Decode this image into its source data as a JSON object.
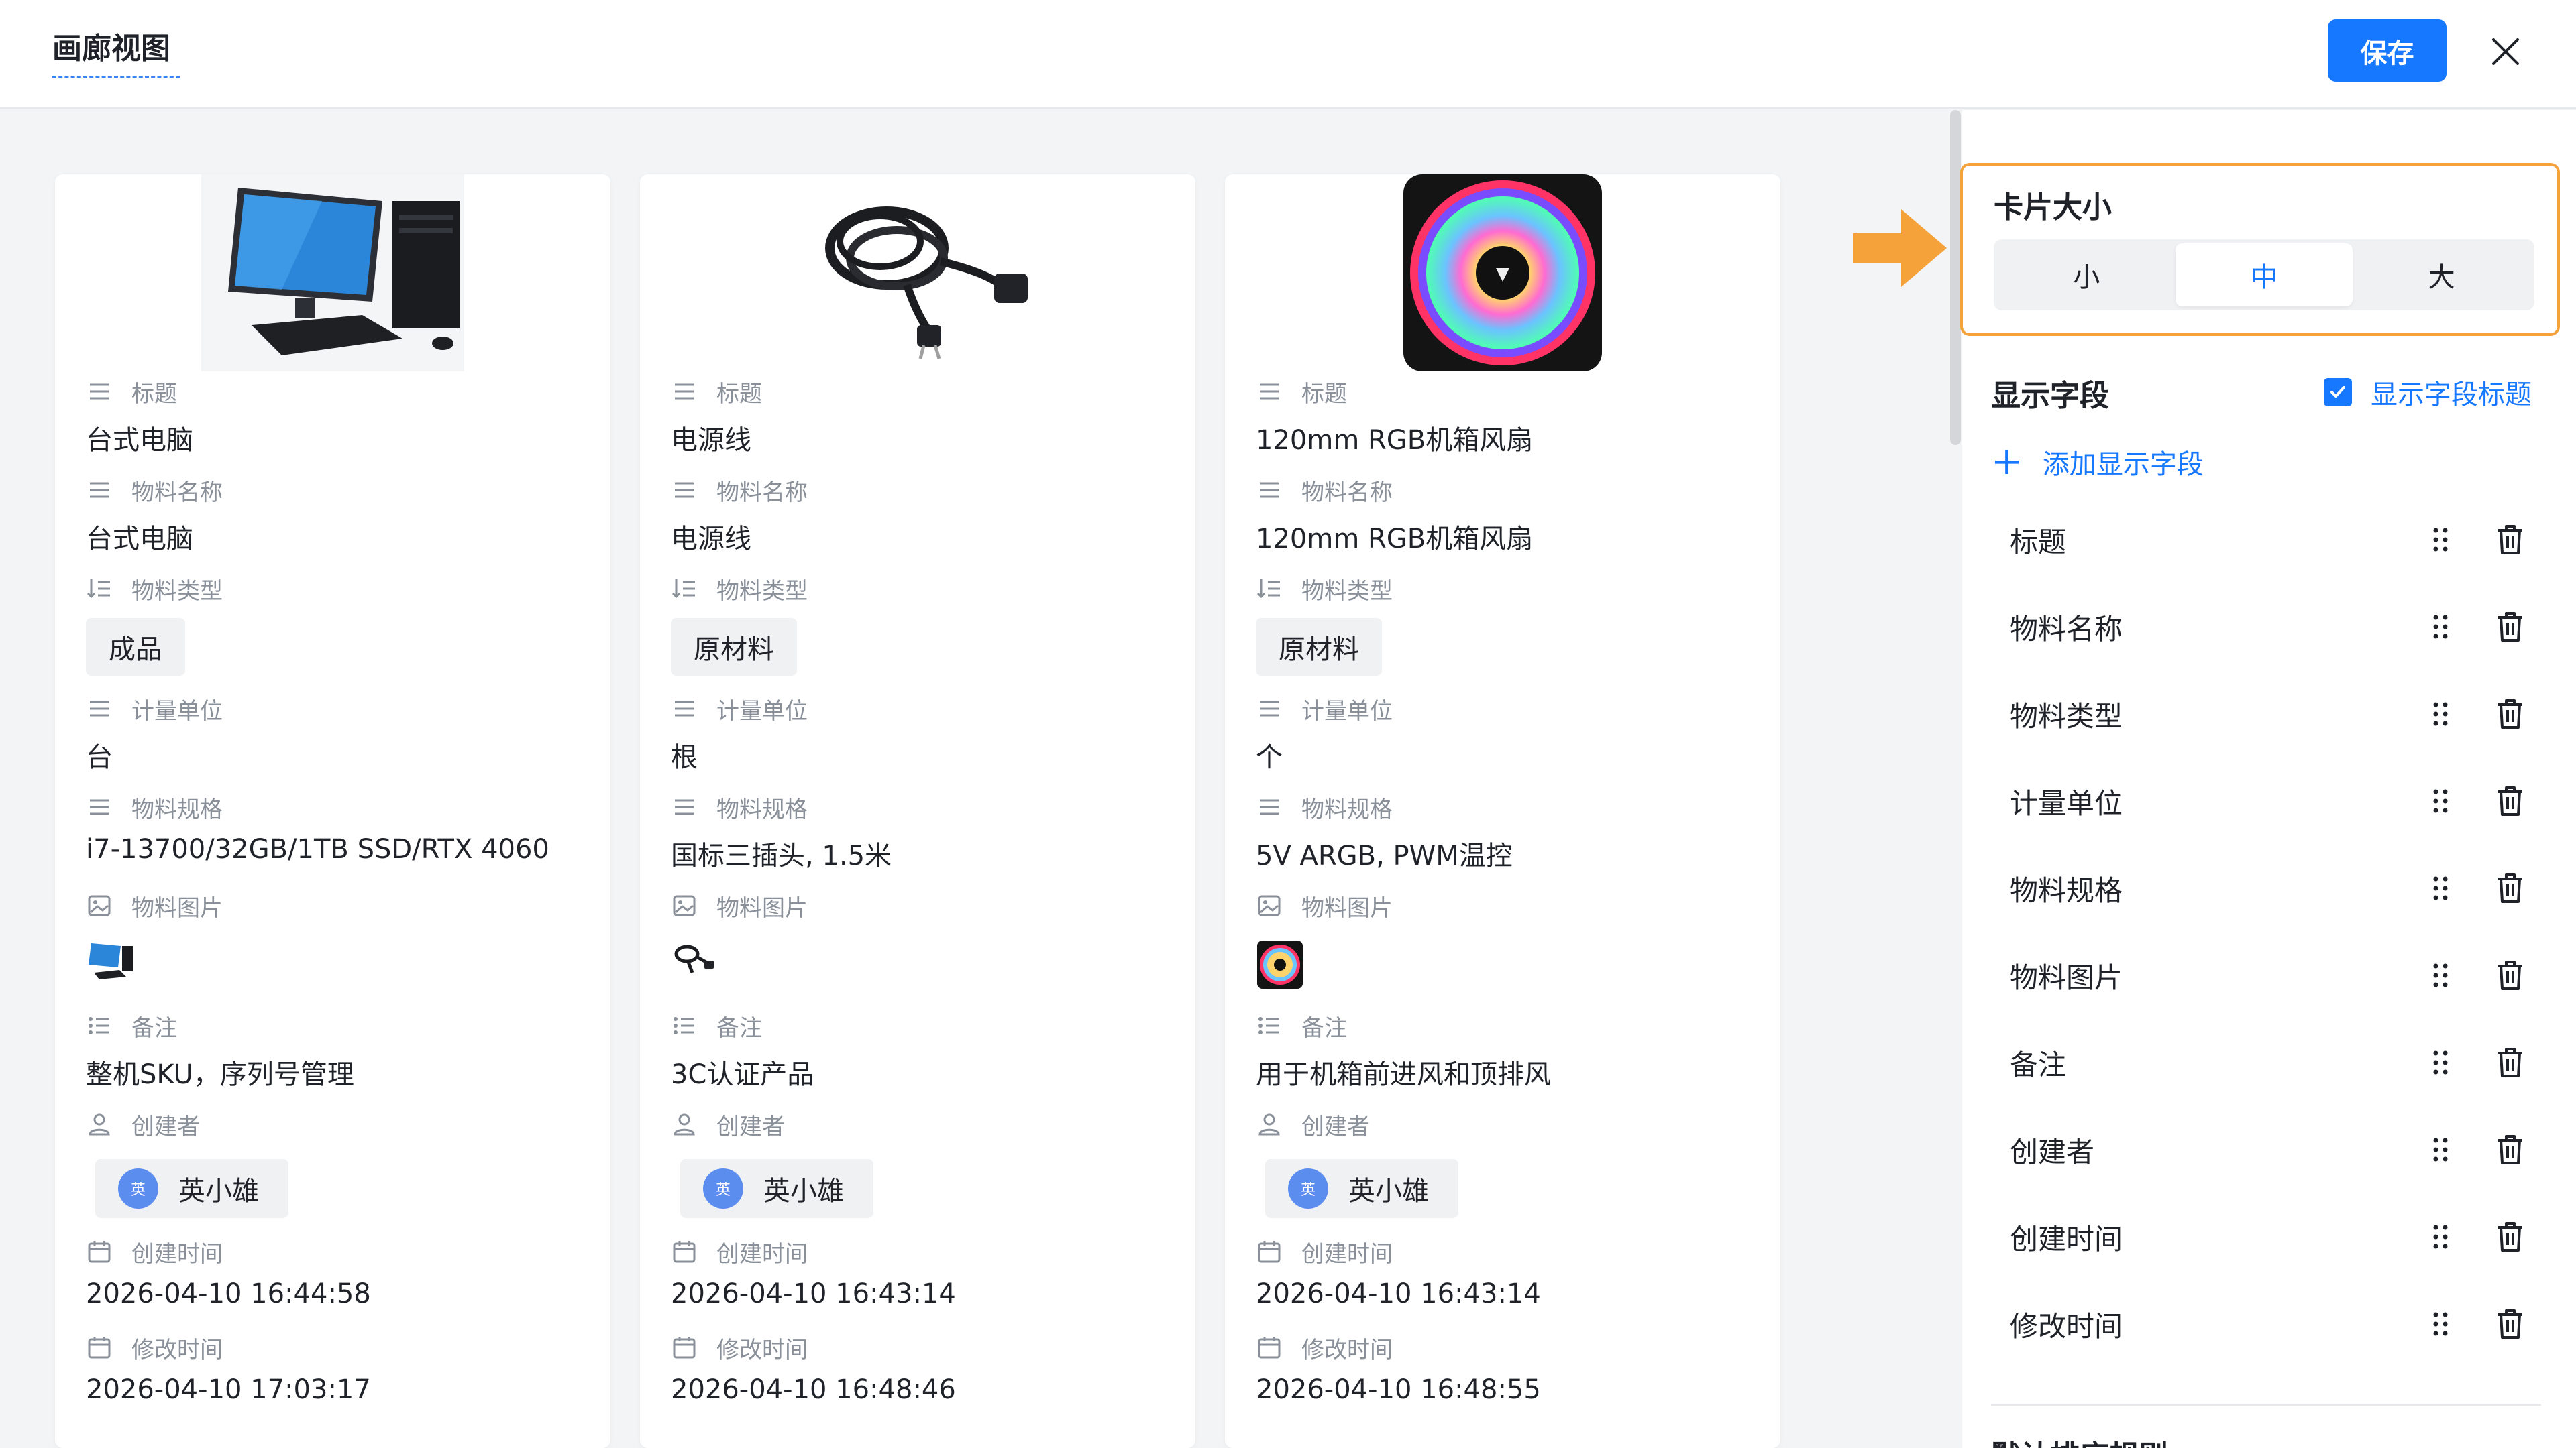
{
  "header": {
    "title": "画廊视图",
    "save_label": "保存"
  },
  "cards": [
    {
      "image": "desktop-computer",
      "fields": {
        "title_label": "标题",
        "title_value": "台式电脑",
        "name_label": "物料名称",
        "name_value": "台式电脑",
        "type_label": "物料类型",
        "type_value": "成品",
        "unit_label": "计量单位",
        "unit_value": "台",
        "spec_label": "物料规格",
        "spec_value": "i7-13700/32GB/1TB SSD/RTX 4060",
        "image_label": "物料图片",
        "note_label": "备注",
        "note_value": "整机SKU，序列号管理",
        "creator_label": "创建者",
        "creator_value": "英小雄",
        "creator_avatar": "英",
        "created_label": "创建时间",
        "created_value": "2026-04-10 16:44:58",
        "modified_label": "修改时间",
        "modified_value": "2026-04-10 17:03:17"
      }
    },
    {
      "image": "power-cable",
      "fields": {
        "title_label": "标题",
        "title_value": "电源线",
        "name_label": "物料名称",
        "name_value": "电源线",
        "type_label": "物料类型",
        "type_value": "原材料",
        "unit_label": "计量单位",
        "unit_value": "根",
        "spec_label": "物料规格",
        "spec_value": "国标三插头, 1.5米",
        "image_label": "物料图片",
        "note_label": "备注",
        "note_value": "3C认证产品",
        "creator_label": "创建者",
        "creator_value": "英小雄",
        "creator_avatar": "英",
        "created_label": "创建时间",
        "created_value": "2026-04-10 16:43:14",
        "modified_label": "修改时间",
        "modified_value": "2026-04-10 16:48:46"
      }
    },
    {
      "image": "rgb-case-fan",
      "fields": {
        "title_label": "标题",
        "title_value": "120mm RGB机箱风扇",
        "name_label": "物料名称",
        "name_value": "120mm RGB机箱风扇",
        "type_label": "物料类型",
        "type_value": "原材料",
        "unit_label": "计量单位",
        "unit_value": "个",
        "spec_label": "物料规格",
        "spec_value": "5V ARGB, PWM温控",
        "image_label": "物料图片",
        "note_label": "备注",
        "note_value": "用于机箱前进风和顶排风",
        "creator_label": "创建者",
        "creator_value": "英小雄",
        "creator_avatar": "英",
        "created_label": "创建时间",
        "created_value": "2026-04-10 16:43:14",
        "modified_label": "修改时间",
        "modified_value": "2026-04-10 16:48:55"
      }
    }
  ],
  "panel": {
    "card_size_label": "卡片大小",
    "size_options": [
      "小",
      "中",
      "大"
    ],
    "size_selected": "中",
    "display_fields_label": "显示字段",
    "show_field_titles_label": "显示字段标题",
    "show_field_titles_checked": true,
    "add_field_label": "添加显示字段",
    "fields": [
      "标题",
      "物料名称",
      "物料类型",
      "计量单位",
      "物料规格",
      "物料图片",
      "备注",
      "创建者",
      "创建时间",
      "修改时间"
    ],
    "next_section_label": "默认排序规则"
  },
  "colors": {
    "accent": "#1677ff",
    "highlight": "#f5a23a"
  }
}
